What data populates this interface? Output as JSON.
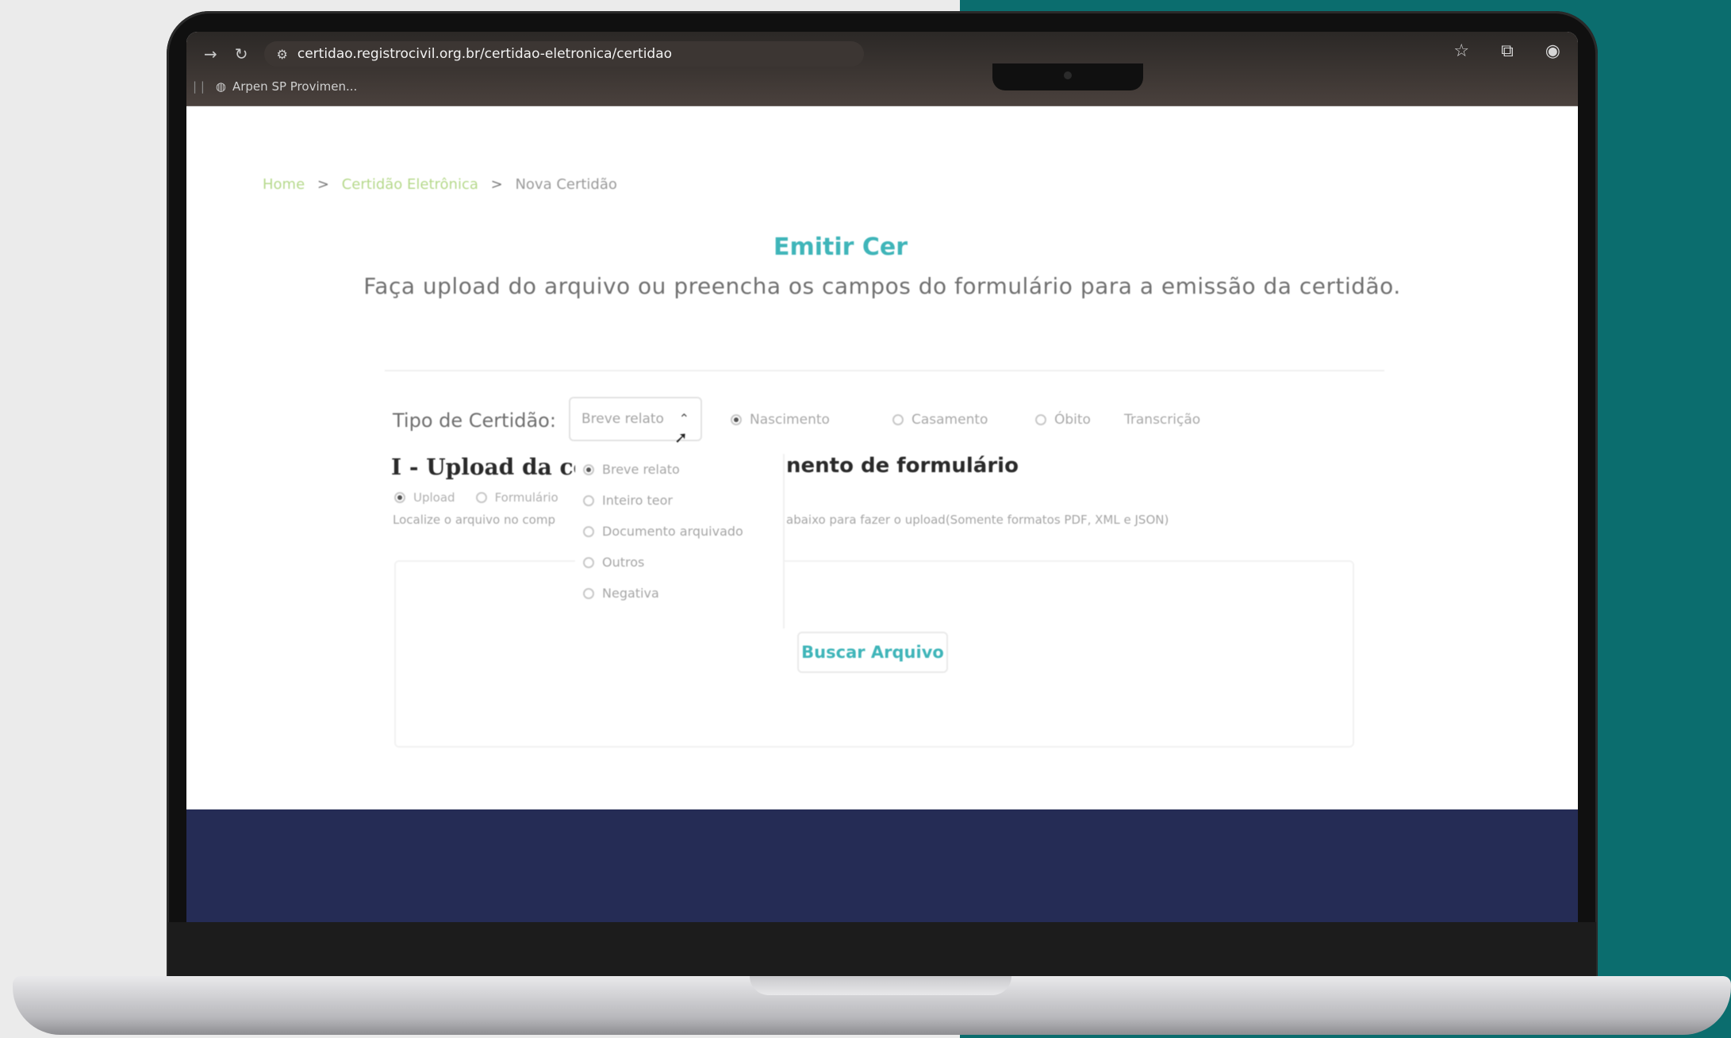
{
  "browser": {
    "url": "certidao.registrocivil.org.br/certidao-eletronica/certidao",
    "bookmark_label": "Arpen SP Provimen..."
  },
  "breadcrumb": {
    "home": "Home",
    "middle": "Certidão Eletrônica",
    "current": "Nova Certidão",
    "separator": ">"
  },
  "page": {
    "title": "Emitir Cer",
    "subtitle": "Faça upload do arquivo ou preencha os campos do formulário para a emissão da certidão."
  },
  "form": {
    "type_label": "Tipo de Certidão:",
    "select_value": "Breve relato",
    "type_options": [
      {
        "label": "Nascimento",
        "selected": true
      },
      {
        "label": "Casamento",
        "selected": false
      },
      {
        "label": "Óbito",
        "selected": false
      },
      {
        "label": "Transcrição",
        "selected": false
      }
    ],
    "dropdown_options": [
      {
        "label": "Breve relato",
        "selected": true
      },
      {
        "label": "Inteiro teor",
        "selected": false
      },
      {
        "label": "Documento arquivado",
        "selected": false
      },
      {
        "label": "Outros",
        "selected": false
      },
      {
        "label": "Negativa",
        "selected": false
      }
    ],
    "section_title_left": "I - Upload da ce",
    "section_title_right": "nento de formulário",
    "upload_option_1": "Upload",
    "upload_option_2": "Formulário",
    "hint_left": "Localize o arquivo no comp",
    "hint_right": "abaixo para fazer o upload(Somente formatos PDF, XML e JSON)",
    "search_button": "Buscar Arquivo"
  },
  "colors": {
    "accent": "#3fb5b9",
    "footer": "#252c55",
    "background_teal": "#0b6d6e"
  }
}
